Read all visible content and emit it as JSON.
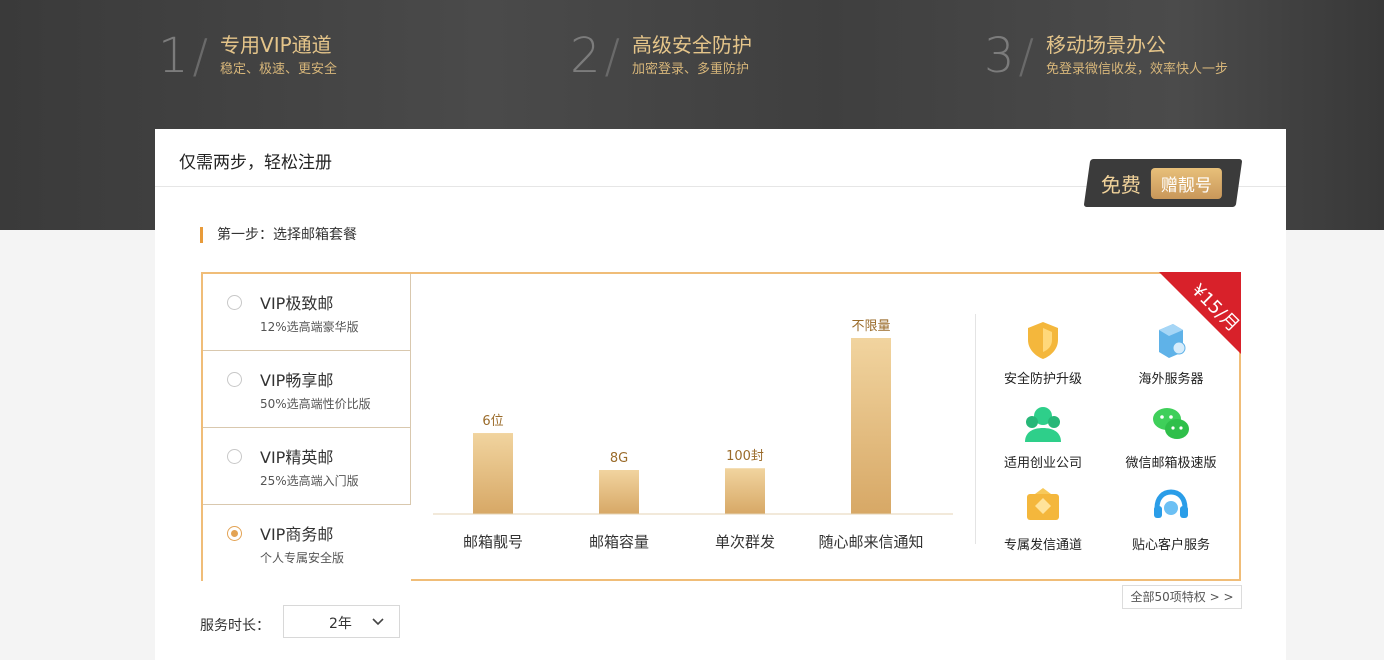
{
  "hero": {
    "features": [
      {
        "num": "1",
        "title": "专用VIP通道",
        "sub": "稳定、极速、更安全"
      },
      {
        "num": "2",
        "title": "高级安全防护",
        "sub": "加密登录、多重防护"
      },
      {
        "num": "3",
        "title": "移动场景办公",
        "sub": "免登录微信收发，效率快人一步"
      }
    ]
  },
  "card": {
    "title": "仅需两步，轻松注册",
    "badge": {
      "free": "免费",
      "nice": "赠靓号"
    },
    "step1": "第一步：选择邮箱套餐",
    "plans": [
      {
        "name": "VIP极致邮",
        "sub": "12%选高端豪华版"
      },
      {
        "name": "VIP畅享邮",
        "sub": "50%选高端性价比版"
      },
      {
        "name": "VIP精英邮",
        "sub": "25%选高端入门版"
      },
      {
        "name": "VIP商务邮",
        "sub": "个人专属安全版"
      }
    ],
    "selected_plan": 3,
    "price_ribbon": "¥15/月",
    "features": [
      {
        "label": "安全防护升级",
        "icon": "shield-icon"
      },
      {
        "label": "海外服务器",
        "icon": "server-icon"
      },
      {
        "label": "适用创业公司",
        "icon": "team-icon"
      },
      {
        "label": "微信邮箱极速版",
        "icon": "wechat-icon"
      },
      {
        "label": "专属发信通道",
        "icon": "mail-channel-icon"
      },
      {
        "label": "贴心客户服务",
        "icon": "headset-icon"
      }
    ],
    "all_privileges": "全部50项特权 > >",
    "duration_label": "服务时长：",
    "duration_value": "2年"
  },
  "chart_data": {
    "type": "bar",
    "categories": [
      "邮箱靓号",
      "邮箱容量",
      "单次群发",
      "随心邮来信通知"
    ],
    "data_labels": [
      "6位",
      "8G",
      "100封",
      "不限量"
    ],
    "relative_heights": [
      0.46,
      0.25,
      0.26,
      1.0
    ]
  },
  "colors": {
    "accent": "#e3a354",
    "bar": "#e2b873",
    "ribbon": "#d8212a",
    "hero_text": "#e5c58a"
  }
}
